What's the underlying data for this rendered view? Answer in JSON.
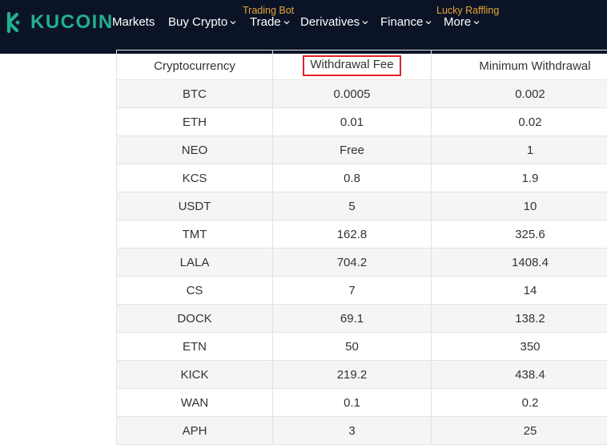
{
  "brand": {
    "name": "KUCOIN",
    "color": "#23af91"
  },
  "nav": {
    "items": [
      {
        "label": "Markets",
        "has_dropdown": false
      },
      {
        "label": "Buy Crypto",
        "has_dropdown": true
      },
      {
        "label": "Trade",
        "has_dropdown": true,
        "badge": "Trading Bot"
      },
      {
        "label": "Derivatives",
        "has_dropdown": true
      },
      {
        "label": "Finance",
        "has_dropdown": true
      },
      {
        "label": "More",
        "has_dropdown": true,
        "badge": "Lucky Raffling"
      }
    ],
    "background": "#0b1426",
    "badge_color": "#e8a43a"
  },
  "table": {
    "headers": [
      "Cryptocurrency",
      "Withdrawal Fee",
      "Minimum Withdrawal"
    ],
    "highlighted_header": "Withdrawal Fee",
    "highlight_color": "#e3222a",
    "rows": [
      [
        "BTC",
        "0.0005",
        "0.002"
      ],
      [
        "ETH",
        "0.01",
        "0.02"
      ],
      [
        "NEO",
        "Free",
        "1"
      ],
      [
        "KCS",
        "0.8",
        "1.9"
      ],
      [
        "USDT",
        "5",
        "10"
      ],
      [
        "TMT",
        "162.8",
        "325.6"
      ],
      [
        "LALA",
        "704.2",
        "1408.4"
      ],
      [
        "CS",
        "7",
        "14"
      ],
      [
        "DOCK",
        "69.1",
        "138.2"
      ],
      [
        "ETN",
        "50",
        "350"
      ],
      [
        "KICK",
        "219.2",
        "438.4"
      ],
      [
        "WAN",
        "0.1",
        "0.2"
      ],
      [
        "APH",
        "3",
        "25"
      ]
    ]
  }
}
